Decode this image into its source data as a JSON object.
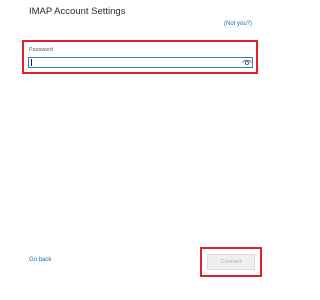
{
  "header": {
    "title": "IMAP Account Settings",
    "not_you_link": "(Not you?)"
  },
  "password": {
    "label": "Password",
    "value": "",
    "eye_icon": "eye-icon"
  },
  "footer": {
    "go_back_link": "Go back",
    "connect_button": "Connect",
    "connect_enabled": false
  },
  "colors": {
    "link": "#0f6cbd",
    "highlight": "#e0212b",
    "input_border": "#2f7bd1",
    "button_disabled_bg": "#efefef",
    "button_disabled_text": "#b4b4b4"
  }
}
